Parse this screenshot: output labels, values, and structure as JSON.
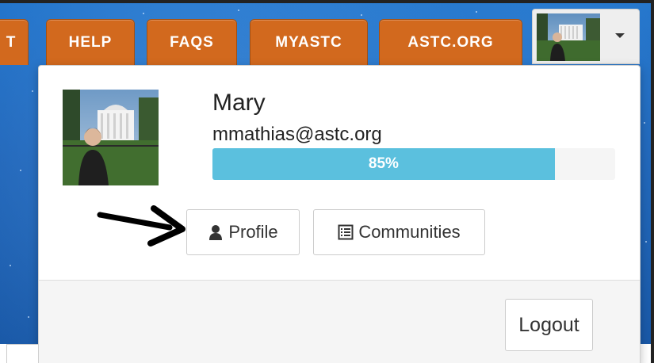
{
  "nav": {
    "tabs": [
      {
        "label": "T"
      },
      {
        "label": "HELP"
      },
      {
        "label": "FAQS"
      },
      {
        "label": "MYASTC"
      },
      {
        "label": "ASTC.ORG"
      }
    ],
    "accent_color": "#d2691e"
  },
  "user_menu": {
    "avatar_icon": "user-photo",
    "caret_icon": "caret-down-icon"
  },
  "profile": {
    "name": "Mary",
    "email": "mmathias@astc.org",
    "progress": {
      "percent": 85,
      "label": "85%",
      "color": "#5bc0de"
    }
  },
  "actions": {
    "profile_label": "Profile",
    "profile_icon": "user-icon",
    "communities_label": "Communities",
    "communities_icon": "list-icon"
  },
  "footer": {
    "logout_label": "Logout"
  }
}
